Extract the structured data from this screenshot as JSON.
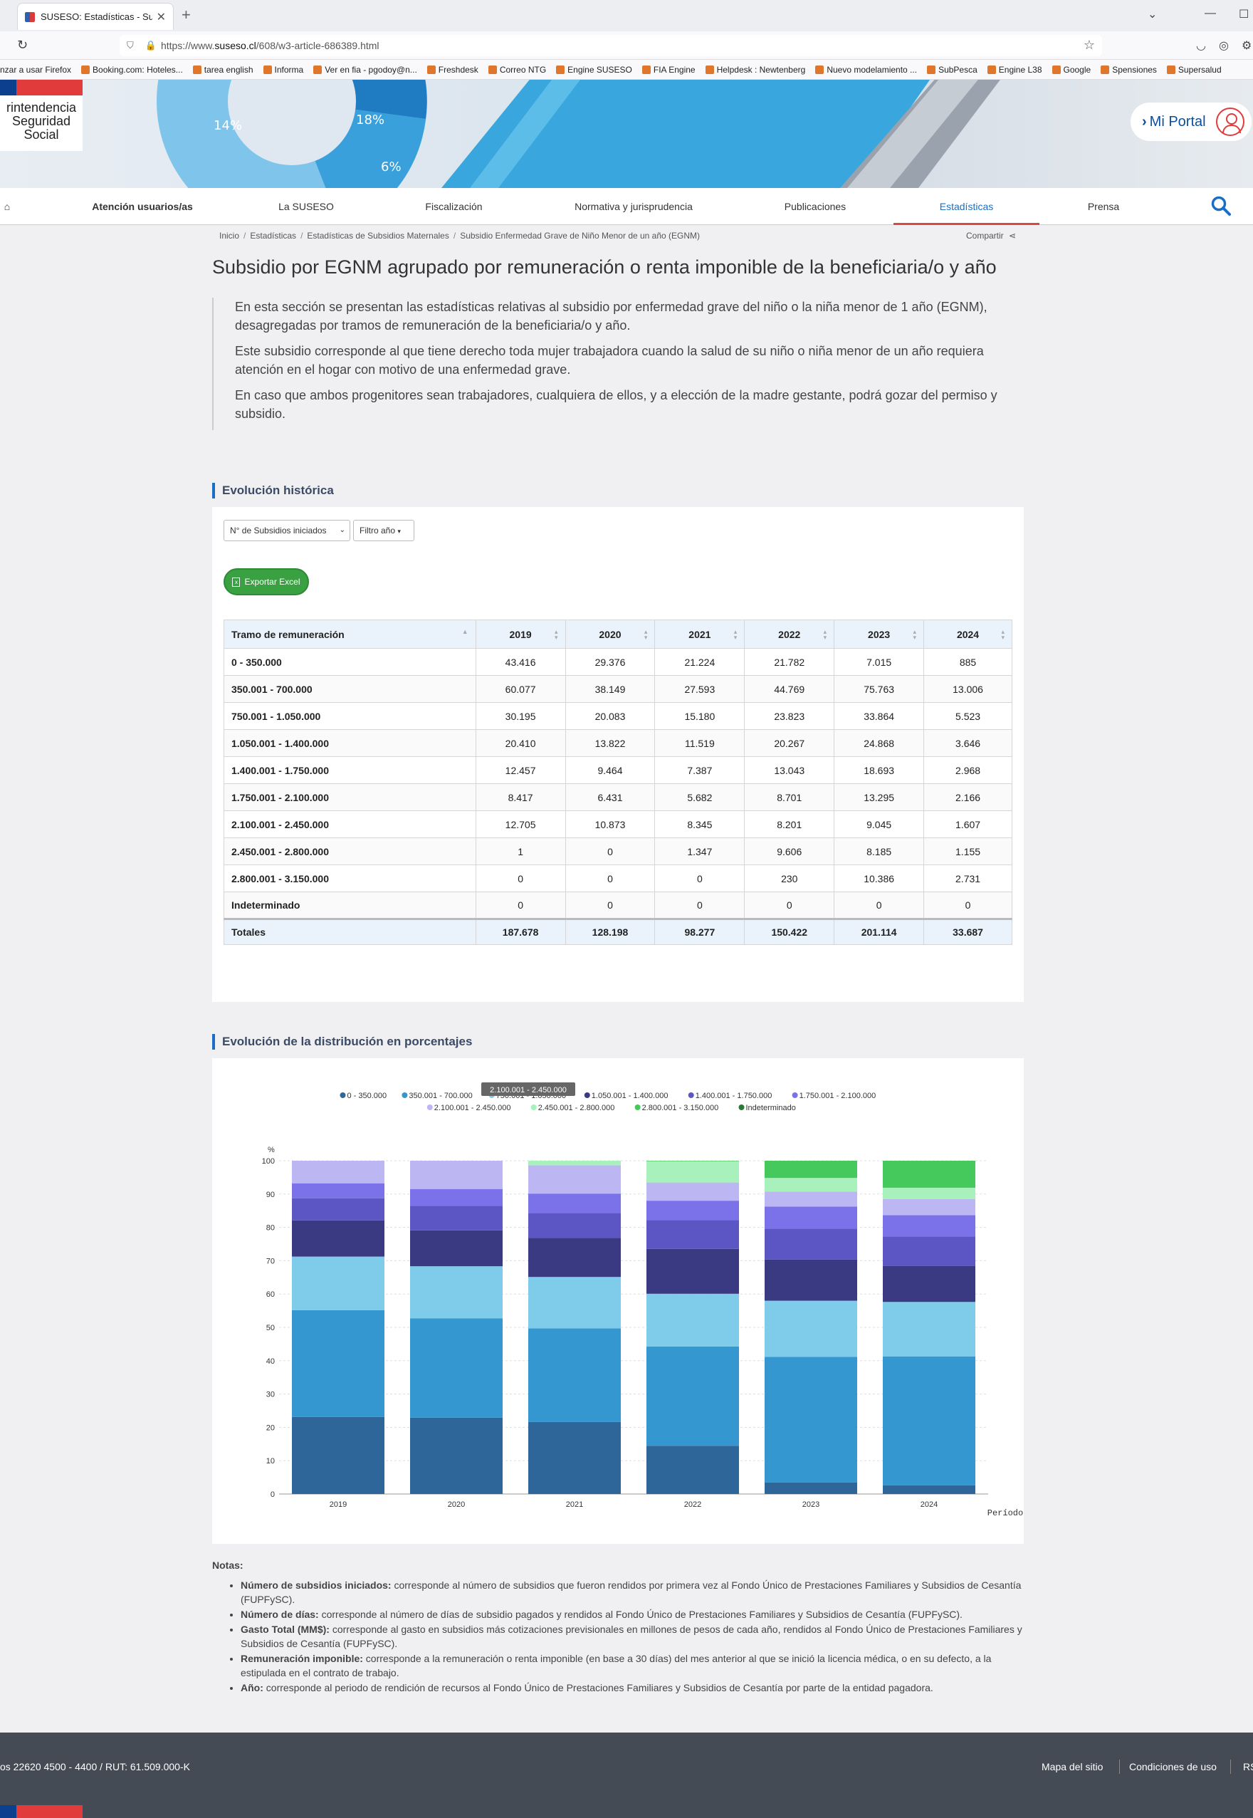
{
  "browser": {
    "tab_title": "SUSESO: Estadísticas - Subsidi",
    "url_prefix": "https://www.",
    "url_domain": "suseso.cl",
    "url_path": "/608/w3-article-686389.html",
    "bookmarks": [
      "nzar a usar Firefox",
      "Booking.com: Hoteles...",
      "tarea english",
      "Informa",
      "Ver en fia - pgodoy@n...",
      "Freshdesk",
      "Correo NTG",
      "Engine SUSESO",
      "FIA Engine",
      "Helpdesk : Newtenberg",
      "Nuevo modelamiento ...",
      "SubPesca",
      "Engine L38",
      "Google",
      "Spensiones",
      "Supersalud"
    ]
  },
  "header": {
    "logo_lines": [
      "rintendencia",
      "Seguridad",
      "Social"
    ],
    "mi_portal": "Mi Portal"
  },
  "nav": {
    "items": [
      "Atención usuarios/as",
      "La SUSESO",
      "Fiscalización",
      "Normativa y jurisprudencia",
      "Publicaciones",
      "Estadísticas",
      "Prensa"
    ]
  },
  "breadcrumb": {
    "items": [
      "Inicio",
      "Estadísticas",
      "Estadísticas de Subsidios Maternales",
      "Subsidio Enfermedad Grave de Niño Menor de un año (EGNM)"
    ],
    "share": "Compartir"
  },
  "page": {
    "title": "Subsidio por EGNM agrupado por remuneración o renta imponible de la beneficiaria/o y año",
    "intro": [
      "En esta sección se presentan las estadísticas relativas al subsidio por enfermedad grave del niño o la niña menor de 1 año (EGNM), desagregadas por tramos de remuneración de la beneficiaria/o y año.",
      "Este subsidio corresponde al que tiene derecho toda mujer trabajadora cuando la salud de su niño o niña menor de un año requiera atención en el hogar con motivo de una enfermedad grave.",
      "En caso que ambos progenitores sean trabajadores, cualquiera de ellos, y a elección de la madre gestante, podrá gozar del permiso y subsidio."
    ]
  },
  "section1": {
    "title": "Evolución histórica",
    "metric_select": "N° de Subsidios iniciados",
    "year_filter": "Filtro año",
    "export_label": "Exportar Excel"
  },
  "table": {
    "headers": [
      "Tramo de remuneración",
      "2019",
      "2020",
      "2021",
      "2022",
      "2023",
      "2024"
    ],
    "rows": [
      [
        "0 - 350.000",
        "43.416",
        "29.376",
        "21.224",
        "21.782",
        "7.015",
        "885"
      ],
      [
        "350.001 - 700.000",
        "60.077",
        "38.149",
        "27.593",
        "44.769",
        "75.763",
        "13.006"
      ],
      [
        "750.001 - 1.050.000",
        "30.195",
        "20.083",
        "15.180",
        "23.823",
        "33.864",
        "5.523"
      ],
      [
        "1.050.001 - 1.400.000",
        "20.410",
        "13.822",
        "11.519",
        "20.267",
        "24.868",
        "3.646"
      ],
      [
        "1.400.001 - 1.750.000",
        "12.457",
        "9.464",
        "7.387",
        "13.043",
        "18.693",
        "2.968"
      ],
      [
        "1.750.001 - 2.100.000",
        "8.417",
        "6.431",
        "5.682",
        "8.701",
        "13.295",
        "2.166"
      ],
      [
        "2.100.001 - 2.450.000",
        "12.705",
        "10.873",
        "8.345",
        "8.201",
        "9.045",
        "1.607"
      ],
      [
        "2.450.001 - 2.800.000",
        "1",
        "0",
        "1.347",
        "9.606",
        "8.185",
        "1.155"
      ],
      [
        "2.800.001 - 3.150.000",
        "0",
        "0",
        "0",
        "230",
        "10.386",
        "2.731"
      ],
      [
        "Indeterminado",
        "0",
        "0",
        "0",
        "0",
        "0",
        "0"
      ]
    ],
    "totals": [
      "Totales",
      "187.678",
      "128.198",
      "98.277",
      "150.422",
      "201.114",
      "33.687"
    ]
  },
  "section2": {
    "title": "Evolución de la distribución en porcentajes",
    "tooltip": "2.100.001 - 2.450.000"
  },
  "chart_data": {
    "type": "bar",
    "stacked": "percent",
    "categories": [
      "2019",
      "2020",
      "2021",
      "2022",
      "2023",
      "2024"
    ],
    "xlabel": "Período",
    "ylabel": "%",
    "ylim": [
      0,
      100
    ],
    "yticks": [
      0,
      10,
      20,
      30,
      40,
      50,
      60,
      70,
      80,
      90,
      100
    ],
    "grid": true,
    "legend_position": "top",
    "series": [
      {
        "name": "0 - 350.000",
        "color": "#2f6699",
        "values": [
          43416,
          29376,
          21224,
          21782,
          7015,
          885
        ]
      },
      {
        "name": "350.001 - 700.000",
        "color": "#3597cf",
        "values": [
          60077,
          38149,
          27593,
          44769,
          75763,
          13006
        ]
      },
      {
        "name": "750.001 - 1.050.000",
        "color": "#7ecbea",
        "values": [
          30195,
          20083,
          15180,
          23823,
          33864,
          5523
        ]
      },
      {
        "name": "1.050.001 - 1.400.000",
        "color": "#3a3a82",
        "values": [
          20410,
          13822,
          11519,
          20267,
          24868,
          3646
        ]
      },
      {
        "name": "1.400.001 - 1.750.000",
        "color": "#5c55c4",
        "values": [
          12457,
          9464,
          7387,
          13043,
          18693,
          2968
        ]
      },
      {
        "name": "1.750.001 - 2.100.000",
        "color": "#7b72ea",
        "values": [
          8417,
          6431,
          5682,
          8701,
          13295,
          2166
        ]
      },
      {
        "name": "2.100.001 - 2.450.000",
        "color": "#bcb7f2",
        "values": [
          12705,
          10873,
          8345,
          8201,
          9045,
          1607
        ]
      },
      {
        "name": "2.450.001 - 2.800.000",
        "color": "#a8f0bc",
        "values": [
          1,
          0,
          1347,
          9606,
          8185,
          1155
        ]
      },
      {
        "name": "2.800.001 - 3.150.000",
        "color": "#46c95c",
        "values": [
          0,
          0,
          0,
          230,
          10386,
          2731
        ]
      },
      {
        "name": "Indeterminado",
        "color": "#2a7a36",
        "values": [
          0,
          0,
          0,
          0,
          0,
          0
        ]
      }
    ]
  },
  "notes": {
    "title": "Notas:",
    "items": [
      {
        "term": "Número de subsidios iniciados:",
        "text": " corresponde al número de subsidios que fueron rendidos por primera vez al Fondo Único de Prestaciones Familiares y Subsidios de Cesantía (FUPFySC)."
      },
      {
        "term": "Número de días:",
        "text": " corresponde al número de días de subsidio pagados y rendidos al Fondo Único de Prestaciones Familiares y Subsidios de Cesantía (FUPFySC)."
      },
      {
        "term": "Gasto Total (MM$):",
        "text": " corresponde al gasto en subsidios más cotizaciones previsionales en millones de pesos de cada año, rendidos al Fondo Único de Prestaciones Familiares y Subsidios de Cesantía (FUPFySC)."
      },
      {
        "term": "Remuneración imponible:",
        "text": " corresponde a la remuneración o renta imponible (en base a 30 días) del mes anterior al que se inició la licencia médica, o en su defecto, a la estipulada en el contrato de trabajo."
      },
      {
        "term": "Año:",
        "text": " corresponde al periodo de rendición de recursos al Fondo Único de Prestaciones Familiares y Subsidios de Cesantía por parte de la entidad pagadora."
      }
    ]
  },
  "footer": {
    "address": "os 22620 4500 - 4400 / RUT: 61.509.000-K",
    "links": [
      "Mapa del sitio",
      "Condiciones de uso",
      "RS"
    ]
  },
  "colors": {
    "accent": "#1a6fc4",
    "nav_active_border": "#d9473f",
    "export_green": "#3aa142",
    "footer_bg": "#454b54",
    "table_header_bg": "#eaf3fb"
  }
}
